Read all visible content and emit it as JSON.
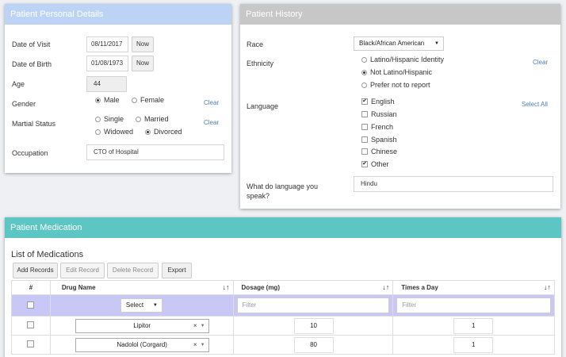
{
  "personal": {
    "title": "Patient Personal Details",
    "colors": {
      "header": "#bcd3f6"
    },
    "date_of_visit": {
      "label": "Date of Visit",
      "value": "08/11/2017",
      "now": "Now"
    },
    "date_of_birth": {
      "label": "Date of Birth",
      "value": "01/08/1973",
      "now": "Now"
    },
    "age": {
      "label": "Age",
      "value": "44"
    },
    "gender": {
      "label": "Gender",
      "options": [
        "Male",
        "Female"
      ],
      "selected": "Male",
      "clear": "Clear"
    },
    "marital": {
      "label": "Martial Status",
      "options": [
        "Single",
        "Married",
        "Widowed",
        "Divorced"
      ],
      "selected": "Divorced",
      "clear": "Clear"
    },
    "occupation": {
      "label": "Occupation",
      "value": "CTO of Hospital"
    }
  },
  "history": {
    "title": "Patient History",
    "colors": {
      "header": "#c7c7c7"
    },
    "race": {
      "label": "Race",
      "value": "Black/African American"
    },
    "ethnicity": {
      "label": "Ethnicity",
      "options": [
        "Latino/Hispanic Identity",
        "Not Latino/Hispanic",
        "Prefer not to report"
      ],
      "selected": "Not Latino/Hispanic",
      "clear": "Clear"
    },
    "language": {
      "label": "Language",
      "select_all": "Select All",
      "options": [
        {
          "name": "English",
          "checked": true
        },
        {
          "name": "Russian",
          "checked": false
        },
        {
          "name": "French",
          "checked": false
        },
        {
          "name": "Spanish",
          "checked": false
        },
        {
          "name": "Chinese",
          "checked": false
        },
        {
          "name": "Other",
          "checked": true
        }
      ]
    },
    "other_language": {
      "label_line1": "What do language you",
      "label_line2": "speak?",
      "value": "Hindu"
    }
  },
  "medication": {
    "title": "Patient Medication",
    "colors": {
      "header": "#5bc6c3",
      "filter_row": "#c9c7f5"
    },
    "list_title": "List of Medications",
    "toolbar": {
      "add": "Add Records",
      "edit": "Edit Record",
      "delete": "Delete Record",
      "export": "Export"
    },
    "columns": {
      "num": "#",
      "drug": "Drug Name",
      "dosage": "Dosage (mg)",
      "times": "Times a Day"
    },
    "filter": {
      "select": "Select",
      "dosage_placeholder": "Filter",
      "times_placeholder": "Filter"
    },
    "rows": [
      {
        "drug": "Lipitor",
        "dosage": "10",
        "times": "1"
      },
      {
        "drug": "Nadolol (Corgard)",
        "dosage": "80",
        "times": "1"
      }
    ]
  }
}
